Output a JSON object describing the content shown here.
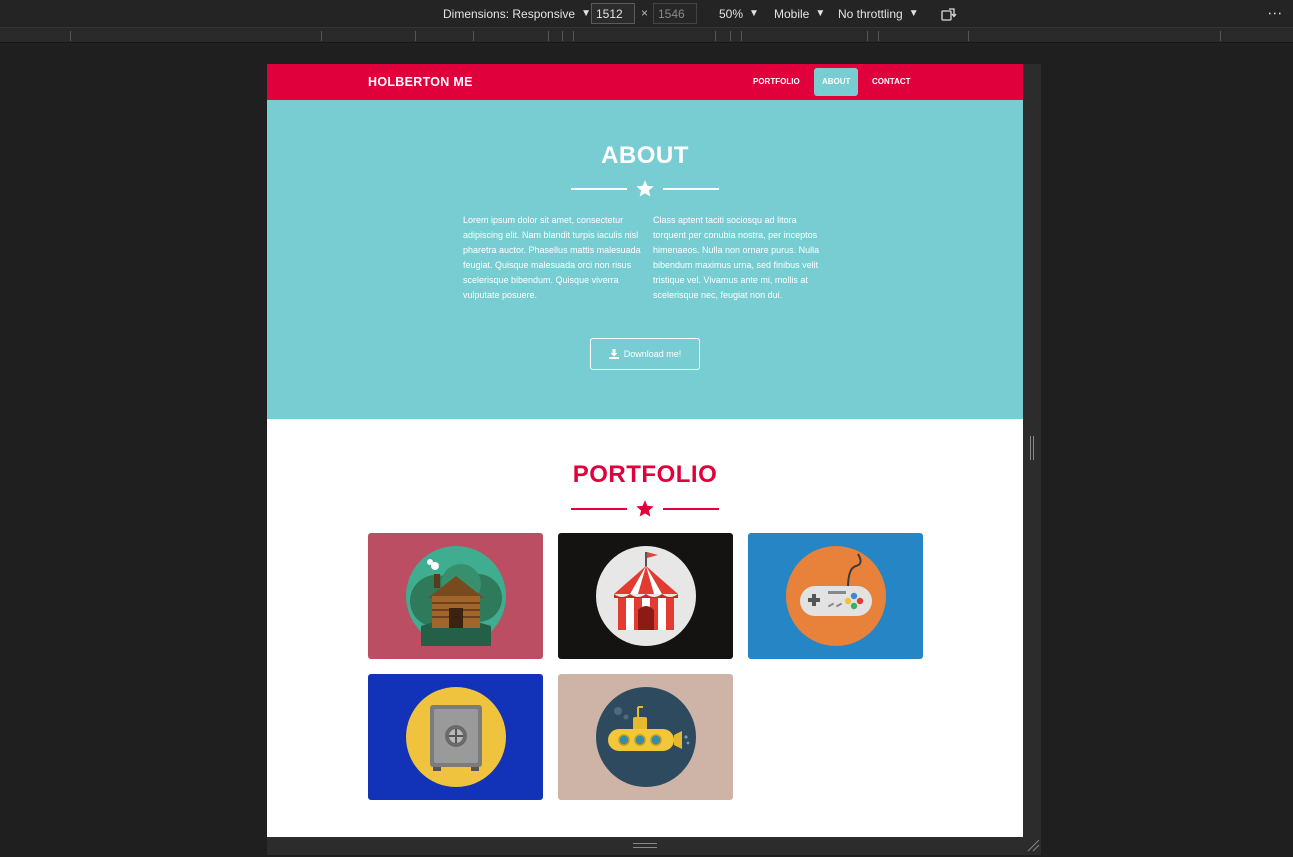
{
  "devtools": {
    "dimensions_label": "Dimensions: Responsive",
    "width": "1512",
    "height": "1546",
    "times": "×",
    "zoom": "50%",
    "device": "Mobile",
    "throttling": "No throttling",
    "more": "⋮"
  },
  "site": {
    "brand": "HOLBERTON ME",
    "nav": [
      {
        "label": "PORTFOLIO",
        "active": false
      },
      {
        "label": "ABOUT",
        "active": true
      },
      {
        "label": "CONTACT",
        "active": false
      }
    ],
    "about": {
      "title": "ABOUT",
      "col1": "Lorem ipsum dolor sit amet, consectetur adipiscing elit. Nam blandit turpis iaculis nisl pharetra auctor. Phasellus mattis malesuada feugiat. Quisque malesuada orci non risus scelerisque bibendum. Quisque viverra vulputate posuere.",
      "col2": "Class aptent taciti sociosqu ad litora torquent per conubia nostra, per inceptos himenaeos. Nulla non ornare purus. Nulla bibendum maximus urna, sed finibus velit tristique vel. Vivamus ante mi, mollis at scelerisque nec, feugiat non dui.",
      "button": "Download me!"
    },
    "portfolio": {
      "title": "PORTFOLIO",
      "items": [
        {
          "icon": "cabin-icon",
          "bg": "#bb4e62",
          "circle": "#3fad8f"
        },
        {
          "icon": "circus-tent-icon",
          "bg": "#151312",
          "circle": "#e7e7e7"
        },
        {
          "icon": "game-controller-icon",
          "bg": "#2685c5",
          "circle": "#e8823a"
        },
        {
          "icon": "safe-icon",
          "bg": "#1233b8",
          "circle": "#efc33d"
        },
        {
          "icon": "submarine-icon",
          "bg": "#ceb4a7",
          "circle": "#2d4a5f"
        }
      ]
    }
  },
  "colors": {
    "primary": "#e0003c",
    "teal": "#78cdd2",
    "white": "#ffffff"
  }
}
